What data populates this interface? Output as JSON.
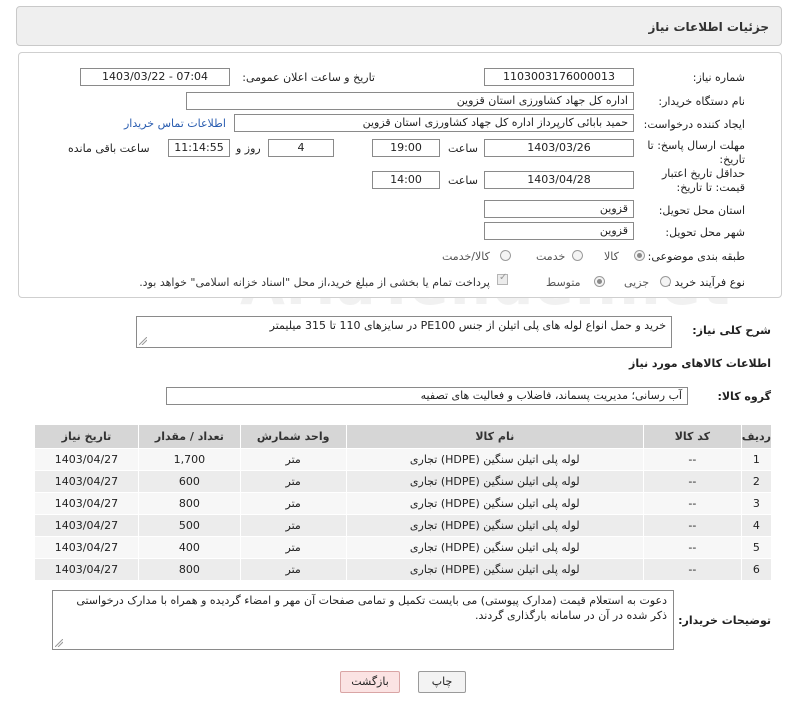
{
  "header": {
    "title": "جزئیات اطلاعات نیاز"
  },
  "form": {
    "need_number_label": "شماره نیاز:",
    "need_number": "1103003176000013",
    "announce_label": "تاریخ و ساعت اعلان عمومی:",
    "announce_value": "1403/03/22 - 07:04",
    "buyer_org_label": "نام دستگاه خریدار:",
    "buyer_org": "اداره کل جهاد کشاورزی استان قزوین",
    "requester_label": "ایجاد کننده درخواست:",
    "requester": "حمید بابائی کارپرداز اداره کل جهاد کشاورزی استان قزوین",
    "contact_link": "اطلاعات تماس خریدار",
    "reply_deadline_label": "مهلت ارسال پاسخ: تا تاریخ:",
    "reply_date": "1403/03/26",
    "time_label": "ساعت",
    "reply_time": "19:00",
    "days_value": "4",
    "days_label": "روز و",
    "remaining_time": "11:14:55",
    "remaining_label": "ساعت باقی مانده",
    "validity_label": "حداقل تاریخ اعتبار قیمت: تا تاریخ:",
    "validity_date": "1403/04/28",
    "validity_time": "14:00",
    "province_label": "استان محل تحویل:",
    "province": "قزوین",
    "city_label": "شهر محل تحویل:",
    "city": "قزوین",
    "category_label": "طبقه بندی موضوعی:",
    "category_options": [
      "کالا",
      "خدمت",
      "کالا/خدمت"
    ],
    "process_label": "نوع فرآیند خرید :",
    "process_options": [
      "جزیی",
      "متوسط"
    ],
    "payment_note": "پرداخت تمام یا بخشی از مبلغ خرید،از محل \"اسناد خزانه اسلامی\" خواهد بود."
  },
  "description": {
    "label": "شرح کلی نیاز:",
    "text": "خرید و حمل انواع لوله های پلی اتیلن از جنس PE100 در سایزهای 110 تا 315 میلیمتر"
  },
  "goods": {
    "section_title": "اطلاعات کالاهای مورد نیاز",
    "group_label": "گروه کالا:",
    "group_value": "آب رسانی؛ مدیریت پسماند، فاضلاب و فعالیت های تصفیه",
    "columns": [
      "ردیف",
      "کد کالا",
      "نام کالا",
      "واحد شمارش",
      "تعداد / مقدار",
      "تاریخ نیاز"
    ],
    "rows": [
      [
        "1",
        "--",
        "لوله پلی اتیلن سنگین (HDPE) تجاری",
        "متر",
        "1,700",
        "1403/04/27"
      ],
      [
        "2",
        "--",
        "لوله پلی اتیلن سنگین (HDPE) تجاری",
        "متر",
        "600",
        "1403/04/27"
      ],
      [
        "3",
        "--",
        "لوله پلی اتیلن سنگین (HDPE) تجاری",
        "متر",
        "800",
        "1403/04/27"
      ],
      [
        "4",
        "--",
        "لوله پلی اتیلن سنگین (HDPE) تجاری",
        "متر",
        "500",
        "1403/04/27"
      ],
      [
        "5",
        "--",
        "لوله پلی اتیلن سنگین (HDPE) تجاری",
        "متر",
        "400",
        "1403/04/27"
      ],
      [
        "6",
        "--",
        "لوله پلی اتیلن سنگین (HDPE) تجاری",
        "متر",
        "800",
        "1403/04/27"
      ]
    ]
  },
  "buyer_notes": {
    "label": "توضیحات خریدار:",
    "text": "دعوت به استعلام قیمت (مدارک پیوستی) می بایست تکمیل و تمامی صفحات آن مهر و امضاء گردیده و همراه با مدارک درخواستی ذکر شده در آن در سامانه بارگذاری گردند."
  },
  "buttons": {
    "print": "چاپ",
    "back": "بازگشت"
  },
  "watermark": "AriaTender.net",
  "colors": {
    "link": "#2a5db0",
    "header_bg": "#efefef",
    "table_header": "#d6d6d6",
    "back_button": "#fbe3e3"
  }
}
